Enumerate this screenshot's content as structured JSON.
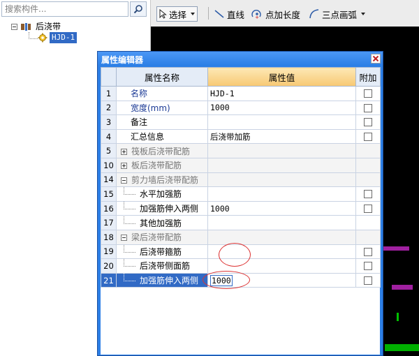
{
  "tree": {
    "search_placeholder": "搜索构件...",
    "root_label": "后浇带",
    "child_label": "HJD-1"
  },
  "toolbar": {
    "select_label": "选择",
    "line_label": "直线",
    "extend_label": "点加长度",
    "arc_label": "三点画弧"
  },
  "dialog": {
    "title": "属性编辑器",
    "columns": {
      "name": "属性名称",
      "value": "属性值",
      "extra": "附加"
    },
    "rows": [
      {
        "num": "1",
        "name": "名称",
        "value": "HJD-1",
        "style": "blue",
        "kind": "plain"
      },
      {
        "num": "2",
        "name": "宽度(mm)",
        "value": "1000",
        "style": "blue",
        "kind": "plain"
      },
      {
        "num": "3",
        "name": "备注",
        "value": "",
        "style": "black",
        "kind": "plain"
      },
      {
        "num": "4",
        "name": "汇总信息",
        "value": "后浇带加筋",
        "style": "black",
        "kind": "plain"
      },
      {
        "num": "5",
        "name": "筏板后浇带配筋",
        "value": "",
        "style": "gray",
        "kind": "group-collapsed"
      },
      {
        "num": "10",
        "name": "板后浇带配筋",
        "value": "",
        "style": "gray",
        "kind": "group-collapsed"
      },
      {
        "num": "14",
        "name": "剪力墙后浇带配筋",
        "value": "",
        "style": "gray",
        "kind": "group-expanded"
      },
      {
        "num": "15",
        "name": "水平加强筋",
        "value": "",
        "style": "black",
        "kind": "child"
      },
      {
        "num": "16",
        "name": "加强筋伸入两侧",
        "value": "1000",
        "style": "black",
        "kind": "child"
      },
      {
        "num": "17",
        "name": "其他加强筋",
        "value": "",
        "style": "black",
        "kind": "child"
      },
      {
        "num": "18",
        "name": "梁后浇带配筋",
        "value": "",
        "style": "gray",
        "kind": "group-expanded"
      },
      {
        "num": "19",
        "name": "后浇带箍筋",
        "value": "",
        "style": "black",
        "kind": "child"
      },
      {
        "num": "20",
        "name": "后浇带侧面筋",
        "value": "",
        "style": "black",
        "kind": "child"
      },
      {
        "num": "21",
        "name": "加强筋伸入两侧",
        "value": "1000",
        "style": "black",
        "kind": "child-selected"
      }
    ]
  },
  "colors": {
    "selection": "#316ac5",
    "dialog_frame": "#2c7fe6",
    "annotation": "#d33333"
  }
}
